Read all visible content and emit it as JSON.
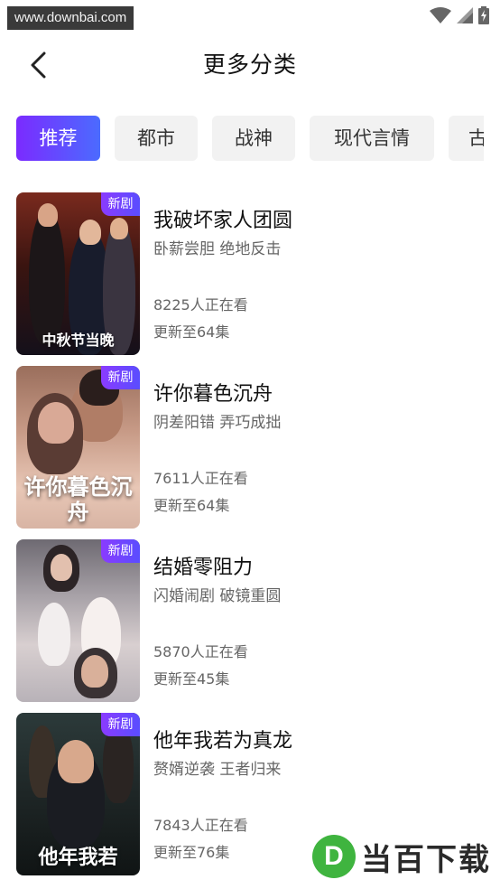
{
  "status_bar": {
    "watermark": "www.downbai.com",
    "icons": [
      "wifi-icon",
      "cellular-signal-icon",
      "battery-charging-icon"
    ]
  },
  "header": {
    "back_icon": "chevron-left-icon",
    "title": "更多分类"
  },
  "tabs": [
    {
      "label": "推荐",
      "active": true
    },
    {
      "label": "都市",
      "active": false
    },
    {
      "label": "战神",
      "active": false
    },
    {
      "label": "现代言情",
      "active": false
    },
    {
      "label": "古",
      "active": false
    }
  ],
  "colors": {
    "accent_start": "#7b2bff",
    "accent_end": "#4b6bff",
    "tab_bg": "#f2f2f2",
    "secondary_text": "#666666"
  },
  "dramas": [
    {
      "badge": "新剧",
      "title": "我破坏家人团圆",
      "tags": "卧薪尝胆 绝地反击",
      "viewers": "8225人正在看",
      "update": "更新至64集",
      "poster_caption": "中秋节当晚"
    },
    {
      "badge": "新剧",
      "title": "许你暮色沉舟",
      "tags": "阴差阳错 弄巧成拙",
      "viewers": "7611人正在看",
      "update": "更新至64集",
      "poster_caption": "许你暮色沉舟"
    },
    {
      "badge": "新剧",
      "title": "结婚零阻力",
      "tags": "闪婚闹剧  破镜重圆",
      "viewers": "5870人正在看",
      "update": "更新至45集",
      "poster_caption": ""
    },
    {
      "badge": "新剧",
      "title": "他年我若为真龙",
      "tags": "赘婿逆袭 王者归来",
      "viewers": "7843人正在看",
      "update": "更新至76集",
      "poster_caption": "他年我若"
    }
  ],
  "watermark_bottom": {
    "logo": "D",
    "text": "当百下载"
  }
}
